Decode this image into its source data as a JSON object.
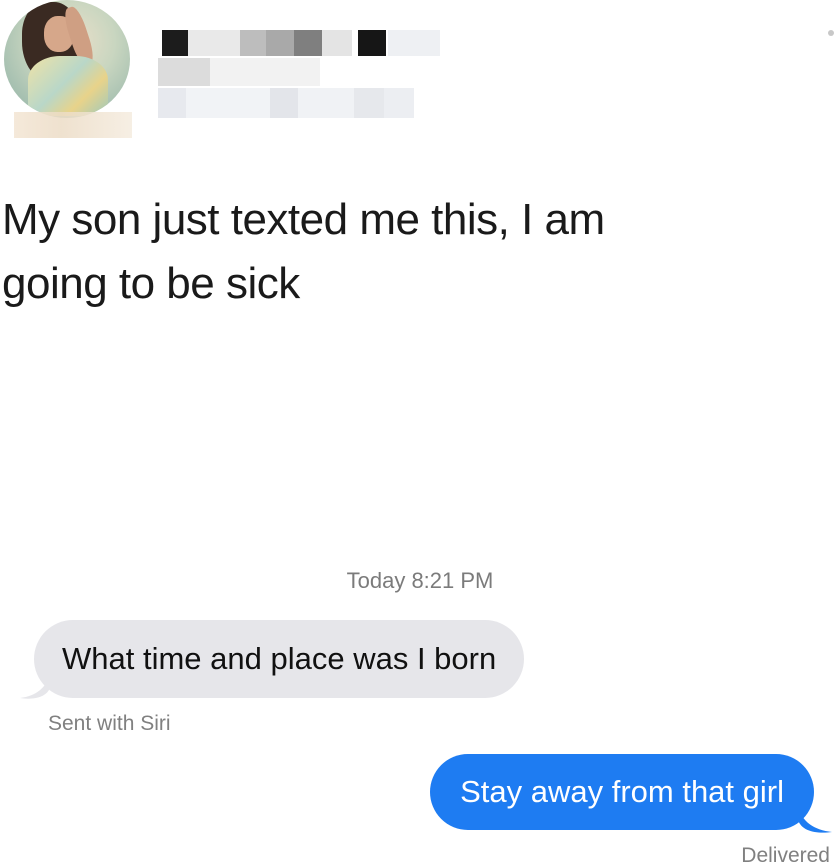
{
  "post": {
    "text_line1": "My son just texted me this, I am",
    "text_line2": "going to be sick"
  },
  "conversation": {
    "timestamp": "Today 8:21 PM",
    "received_message": "What time and place was I born",
    "received_note": "Sent with Siri",
    "sent_message": "Stay away from that girl",
    "sent_status": "Delivered"
  },
  "colors": {
    "incoming_bubble": "#e6e6ea",
    "outgoing_bubble": "#1e7cf2",
    "meta_text": "#808080"
  },
  "icons": {
    "avatar": "profile-photo",
    "menu": "more-dot-icon"
  }
}
